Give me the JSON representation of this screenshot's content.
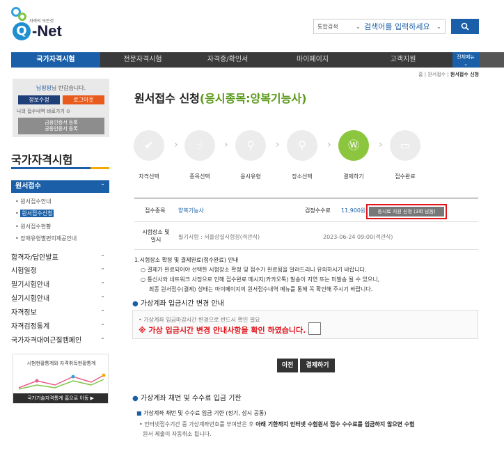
{
  "header": {
    "logo_tagline": "자격의 모든것",
    "logo_q": "Q",
    "logo_net": "-Net",
    "search_category": "통합검색",
    "search_placeholder": "검색어를 입력하세요"
  },
  "nav": {
    "items": [
      "국가자격시험",
      "전문자격시험",
      "자격증/확인서",
      "마이페이지",
      "고객지원"
    ],
    "all_menu": "전체메뉴"
  },
  "sidebar": {
    "greeting_name": "님",
    "greeting_text": "님 반갑습니다.",
    "info_btn": "정보수정",
    "logout_btn": "로그아웃",
    "history": "나의 접수내역 바로가기",
    "cert_line1": "금융인증서 등록",
    "cert_line2": "공동인증서 등록",
    "title": "국가자격시험",
    "section": "원서접수",
    "subitems": [
      "원서접수안내",
      "원서접수신청",
      "원서접수현황",
      "장애유형별편의제공안내"
    ],
    "menu": [
      "합격자/답안발표",
      "시험일정",
      "필기시험안내",
      "실기시험안내",
      "자격정보",
      "자격검정통계",
      "국가자격대여근절캠페인"
    ],
    "stats_title": "시험현황통계와 자격취득현황통계",
    "stats_link": "국가기술자격통계 홈으로 이동"
  },
  "main": {
    "breadcrumb_home": "홈",
    "breadcrumb_mid": "원서접수",
    "breadcrumb_current": "원서접수 신청",
    "title_prefix": "원서접수 신청",
    "title_highlight": "(응시종목:양복기능사)",
    "steps": [
      "자격선택",
      "종목선택",
      "응시유형",
      "장소선택",
      "결제하기",
      "접수완료"
    ],
    "exam_label": "접수종목",
    "exam_value": "양복기능사",
    "fee_label": "검정수수료",
    "fee_value": "11,900원",
    "pay_btn": "응시료 지원 신청 (3회 남음)",
    "place_label_1": "시험장소 및",
    "place_label_2": "일시",
    "place_value": "필기시험 : 서울상설시험장(격관식)",
    "date_value": "2023-06-24 09:00(격관식)",
    "notice_1": "1.시험장소 확정 및 결제완료(접수완료) 안내",
    "notice_1a": "○ 결제가 완료되어야 선택한 시험장소 확정 및 접수가 완료됨을 알려드리니 유의하시기 바랍니다.",
    "notice_1b": "○ 통신사와 네트워크 사정으로 인해 접수완료 메시지(카카오톡) 발송이 지연 또는 미발송 될 수 있으니,",
    "notice_1c": "최종 원서접수(결제) 상태는 마이페이지의 원서접수내역 메뉴를 통해 꼭 확인해 주시기 바랍니다.",
    "section_2": "가상계좌 입금시간 변경 안내",
    "box_line1": "• 가상계좌 입금마감시간 변경으로 반드시 확인 필요",
    "box_line2": "※ 가상 입금시간 변경 안내사항을 확인 하였습니다.",
    "btn_prev": "이전",
    "btn_pay": "결제하기",
    "section_3": "가상계좌 채번 및 수수료 입금 기한",
    "deadline_head": "가상계좌 채번 및 수수료 입금 기한 (정기, 상시 공통)",
    "deadline_1": "• 인터넷접수기간 중 가상계좌번호를 부여받은 후",
    "deadline_1b": "아래 기한까지 인터넷 수험원서 접수 수수료를 입금하지 않으면 수험",
    "deadline_2": "원서 제출이 자동취소 됩니다."
  }
}
